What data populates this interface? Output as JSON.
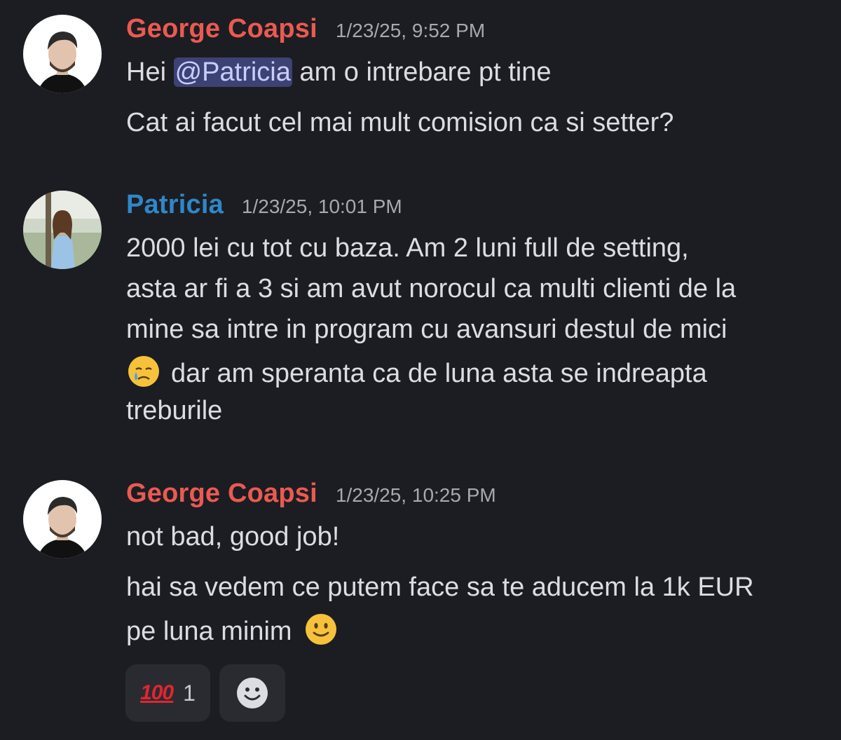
{
  "messages": [
    {
      "author": "George Coapsi",
      "timestamp": "1/23/25, 9:52 PM",
      "author_color": "#ea5a52",
      "line1_pre": "Hei ",
      "mention": "@Patricia",
      "line1_post": " am o intrebare pt tine",
      "line2": "Cat ai facut cel mai mult comision ca si setter?"
    },
    {
      "author": "Patricia",
      "timestamp": "1/23/25, 10:01 PM",
      "author_color": "#2f87c9",
      "lines": [
        "2000 lei cu tot cu baza. Am 2 luni full de setting,",
        "asta ar fi a 3 si am avut norocul ca multi clienti de la",
        "mine sa intre in program cu avansuri destul de mici",
        "dar am speranta ca de luna asta se indreapta",
        "treburile"
      ],
      "emoji": "crying-face-icon"
    },
    {
      "author": "George Coapsi",
      "timestamp": "1/23/25, 10:25 PM",
      "author_color": "#ea5a52",
      "lines": [
        "not bad, good job!",
        "hai sa vedem ce putem face sa te aducem la 1k EUR",
        "pe luna minim"
      ],
      "emoji": "slightly-smiling-face-icon"
    }
  ],
  "reactions": {
    "hundred": {
      "glyph": "100",
      "count": "1"
    },
    "add_reaction_icon": "add-reaction-smiley-icon"
  }
}
